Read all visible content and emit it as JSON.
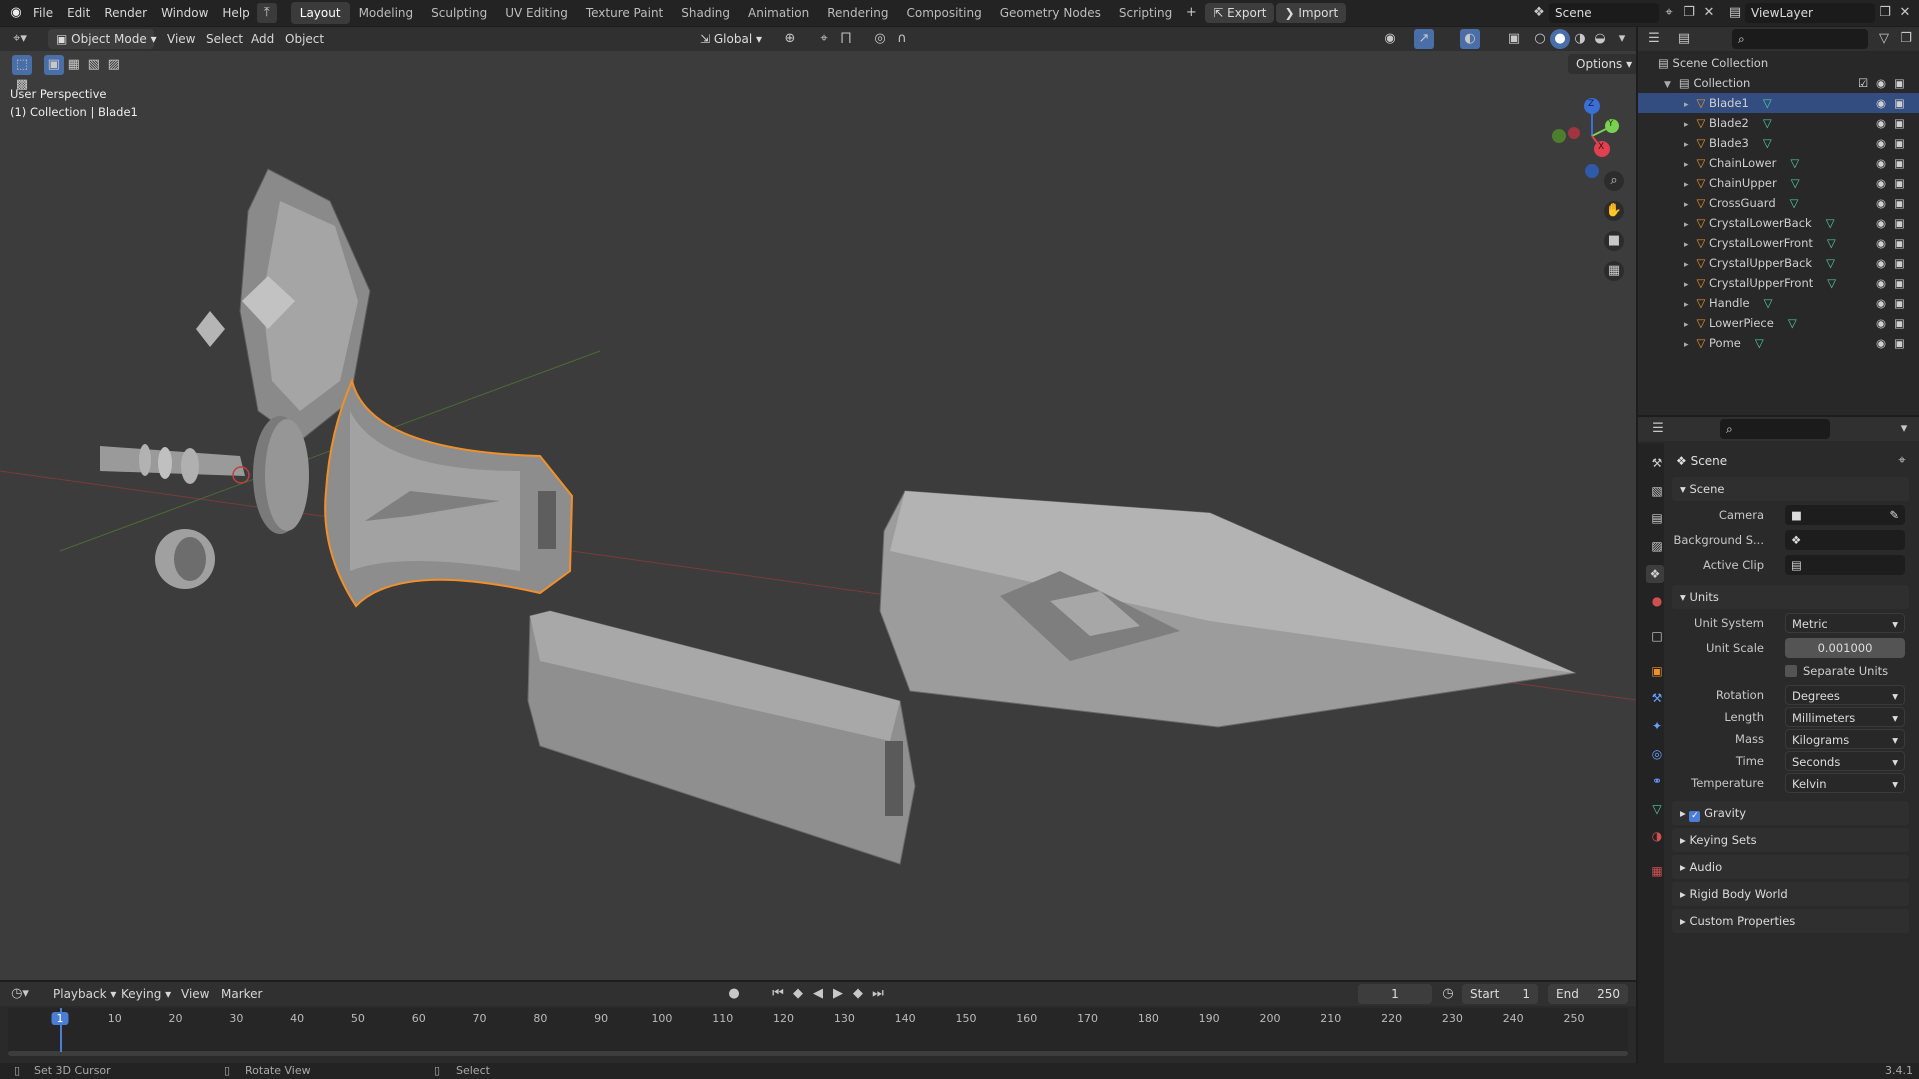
{
  "topbar": {
    "menus": [
      "File",
      "Edit",
      "Render",
      "Window",
      "Help"
    ],
    "workspaces": [
      "Layout",
      "Modeling",
      "Sculpting",
      "UV Editing",
      "Texture Paint",
      "Shading",
      "Animation",
      "Rendering",
      "Compositing",
      "Geometry Nodes",
      "Scripting"
    ],
    "active_workspace": "Layout",
    "export_label": "Export",
    "import_label": "Import",
    "scene_name": "Scene",
    "viewlayer_name": "ViewLayer"
  },
  "viewport_header": {
    "mode": "Object Mode",
    "menus": [
      "View",
      "Select",
      "Add",
      "Object"
    ],
    "orientation": "Global",
    "options_label": "Options"
  },
  "viewport": {
    "perspective": "User Perspective",
    "collection_info": "(1) Collection | Blade1",
    "axis_x": "X",
    "axis_y": "Y",
    "axis_z": "Z",
    "selection_color": "#f0902a",
    "background_color": "#3c3c3c"
  },
  "outliner": {
    "scene_collection": "Scene Collection",
    "collection": "Collection",
    "objects": [
      "Blade1",
      "Blade2",
      "Blade3",
      "ChainLower",
      "ChainUpper",
      "CrossGuard",
      "CrystalLowerBack",
      "CrystalLowerFront",
      "CrystalUpperBack",
      "CrystalUpperFront",
      "Handle",
      "LowerPiece",
      "Pome"
    ],
    "selected": "Blade1"
  },
  "properties": {
    "tab_title": "Scene",
    "scene_panel": "Scene",
    "camera_label": "Camera",
    "background_label": "Background S...",
    "active_clip_label": "Active Clip",
    "units_panel": "Units",
    "unit_system_label": "Unit System",
    "unit_system": "Metric",
    "unit_scale_label": "Unit Scale",
    "unit_scale": "0.001000",
    "separate_units": "Separate Units",
    "rotation_label": "Rotation",
    "rotation": "Degrees",
    "length_label": "Length",
    "length": "Millimeters",
    "mass_label": "Mass",
    "mass": "Kilograms",
    "time_label": "Time",
    "time": "Seconds",
    "temperature_label": "Temperature",
    "temperature": "Kelvin",
    "gravity": "Gravity",
    "keying_sets": "Keying Sets",
    "audio": "Audio",
    "rigid_body_world": "Rigid Body World",
    "custom_properties": "Custom Properties"
  },
  "timeline": {
    "menus": [
      "Playback",
      "Keying",
      "View",
      "Marker"
    ],
    "current_frame": "1",
    "start_label": "Start",
    "start": "1",
    "end_label": "End",
    "end": "250",
    "ticks": [
      "1",
      "10",
      "20",
      "30",
      "40",
      "50",
      "60",
      "70",
      "80",
      "90",
      "100",
      "110",
      "120",
      "130",
      "140",
      "150",
      "160",
      "170",
      "180",
      "190",
      "200",
      "210",
      "220",
      "230",
      "240",
      "250"
    ]
  },
  "statusbar": {
    "hint1": "Set 3D Cursor",
    "hint2": "Rotate View",
    "hint3": "Select",
    "version": "3.4.1"
  }
}
